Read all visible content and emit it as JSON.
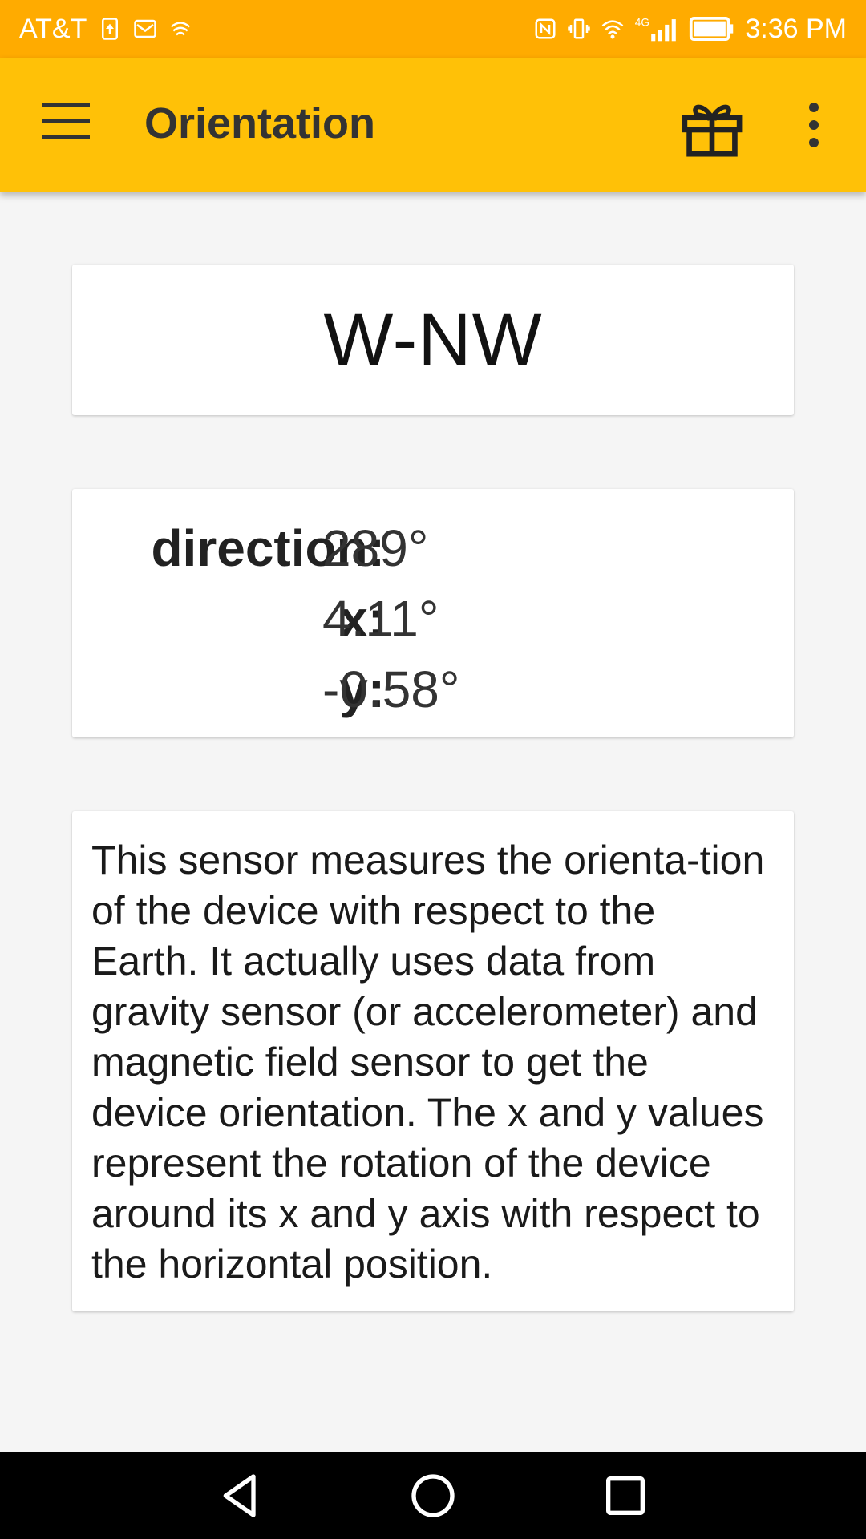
{
  "status_bar": {
    "carrier": "AT&T",
    "network": "4G",
    "time": "3:36 PM",
    "background": "#ffab00"
  },
  "app_bar": {
    "title": "Orientation",
    "background": "#ffc107",
    "menu_icon": "hamburger-menu-icon",
    "gift_icon": "gift-icon",
    "more_icon": "more-vert-icon"
  },
  "compass": {
    "direction": "W-NW"
  },
  "values": [
    {
      "label": "direction:",
      "value": "289°"
    },
    {
      "label": "x:",
      "value": "4.11°"
    },
    {
      "label": "y:",
      "value": "-0.58°"
    }
  ],
  "description": {
    "text": "This sensor measures the orienta-tion of the device with respect to the Earth. It actually uses data from gravity sensor (or accelerometer) and magnetic field sensor to get the device orientation. The x and y values represent the rotation of the device around its x and y axis with respect to the horizontal position."
  },
  "nav_bar": {
    "back_icon": "back-triangle-icon",
    "home_icon": "home-circle-icon",
    "recents_icon": "recents-square-icon"
  }
}
